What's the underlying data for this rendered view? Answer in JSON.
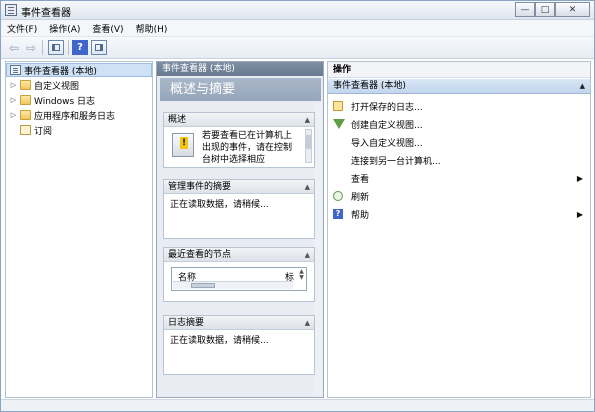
{
  "window": {
    "title": "事件查看器"
  },
  "window_buttons": {
    "minimize": "—",
    "maximize": "□",
    "close": "✕"
  },
  "menubar": {
    "items": [
      "文件(F)",
      "操作(A)",
      "查看(V)",
      "帮助(H)"
    ]
  },
  "toolbar": {
    "back_glyph": "⇦",
    "forward_glyph": "⇨",
    "help_glyph": "?"
  },
  "tree": {
    "root": "事件查看器 (本地)",
    "items": [
      {
        "label": "自定义视图",
        "icon": "folder-icon"
      },
      {
        "label": "Windows 日志",
        "icon": "folder-icon"
      },
      {
        "label": "应用程序和服务日志",
        "icon": "folder-icon"
      },
      {
        "label": "订阅",
        "icon": "subscriptions-icon"
      }
    ]
  },
  "middle": {
    "header": "事件查看器 (本地)",
    "banner": "概述与摘要",
    "sections": {
      "overview": {
        "title": "概述",
        "text": "若要查看已在计算机上出现的事件，请在控制台树中选择相应"
      },
      "managed": {
        "title": "管理事件的摘要",
        "text": "正在读取数据，请稍候..."
      },
      "recent": {
        "title": "最近查看的节点",
        "column": "名称",
        "column_tail": "标"
      },
      "log_summary": {
        "title": "日志摘要",
        "text": "正在读取数据，请稍候..."
      }
    }
  },
  "actions": {
    "header": "操作",
    "group": "事件查看器 (本地)",
    "items": [
      {
        "label": "打开保存的日志...",
        "icon": "folder-open-icon"
      },
      {
        "label": "创建自定义视图...",
        "icon": "filter-icon"
      },
      {
        "label": "导入自定义视图...",
        "icon": ""
      },
      {
        "label": "连接到另一台计算机...",
        "icon": ""
      },
      {
        "label": "查看",
        "icon": "",
        "submenu": true
      },
      {
        "label": "刷新",
        "icon": "refresh-icon"
      },
      {
        "label": "帮助",
        "icon": "help-icon",
        "submenu": true
      }
    ]
  },
  "colors": {
    "selection": "#cfe1f5",
    "mid_header": "#687a90",
    "action_group": "#c2d6ee"
  }
}
